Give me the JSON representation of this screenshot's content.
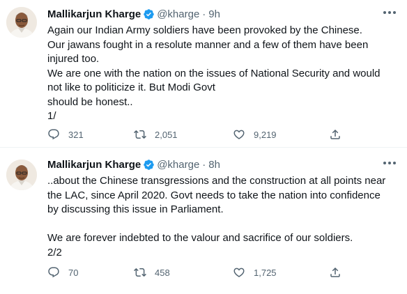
{
  "tweets": [
    {
      "author": "Mallikarjun Kharge",
      "handle": "@kharge",
      "separator": "·",
      "time": "9h",
      "lines": [
        "Again our Indian Army soldiers have been provoked by the Chinese.",
        "Our jawans fought in a resolute manner and a few of them have been",
        "injured too.",
        "We are one with the nation on the issues of National Security and would",
        "not like to politicize it. But Modi Govt",
        "should be honest..",
        "1/"
      ],
      "replies": "321",
      "retweets": "2,051",
      "likes": "9,219"
    },
    {
      "author": "Mallikarjun Kharge",
      "handle": "@kharge",
      "separator": "·",
      "time": "8h",
      "lines": [
        "..about the Chinese transgressions and the construction at all points near",
        "the LAC, since April 2020. Govt needs to take the nation into confidence",
        "by discussing this issue in Parliament.",
        "",
        "We are forever indebted to the valour and sacrifice of our soldiers.",
        "2/2"
      ],
      "replies": "70",
      "retweets": "458",
      "likes": "1,725"
    }
  ],
  "icons": {
    "verified": "verified-badge-icon",
    "reply": "reply-icon",
    "retweet": "retweet-icon",
    "like": "heart-icon",
    "share": "share-icon",
    "more": "more-icon"
  },
  "colors": {
    "text": "#0f1419",
    "secondary": "#536471",
    "verified": "#1d9bf0",
    "divider": "#eff3f4"
  }
}
